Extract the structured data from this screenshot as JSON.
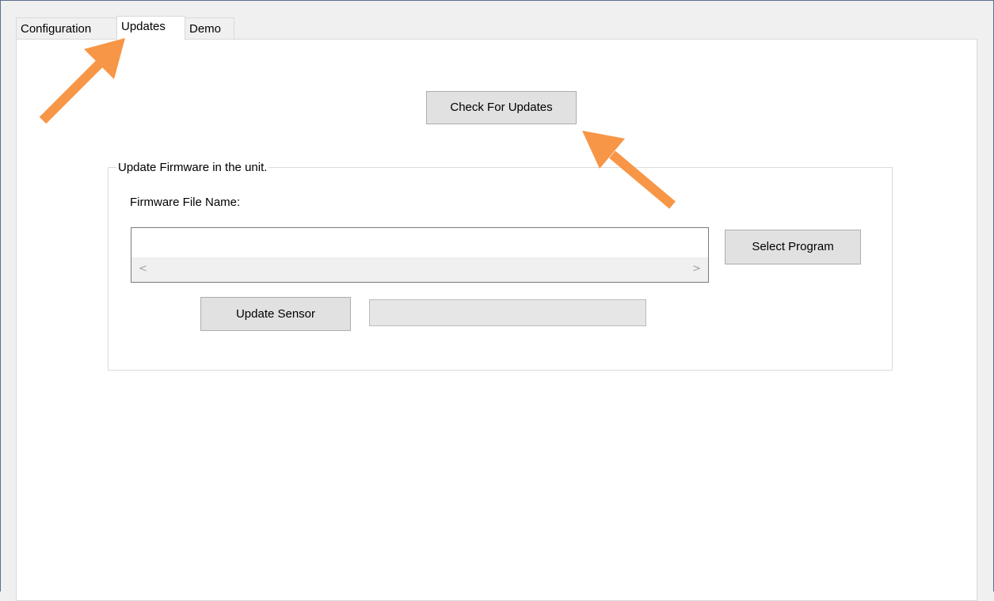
{
  "tabs": [
    {
      "label": "Configuration",
      "active": false
    },
    {
      "label": "Updates",
      "active": true
    },
    {
      "label": "Demo",
      "active": false
    }
  ],
  "updates_panel": {
    "check_button": "Check For Updates",
    "group_title": "Update Firmware in the unit.",
    "firmware_label": "Firmware File Name:",
    "firmware_value": "",
    "select_button": "Select Program",
    "update_button": "Update Sensor",
    "progress_percent": 0
  },
  "scrollbar": {
    "left_arrow": "<",
    "right_arrow": ">"
  },
  "annotations": {
    "arrow_color": "#f79646",
    "arrow_icons": [
      "arrow-up-right-icon",
      "arrow-up-left-icon"
    ]
  }
}
